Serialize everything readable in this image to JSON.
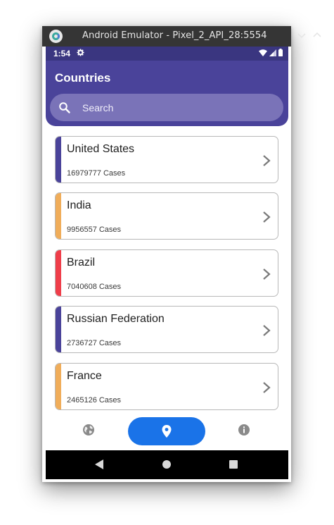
{
  "window": {
    "title": "Android Emulator - Pixel_2_API_28:5554"
  },
  "status_bar": {
    "time": "1:54"
  },
  "app": {
    "title": "Countries",
    "search_placeholder": "Search"
  },
  "countries": [
    {
      "name": "United States",
      "cases": "16979777",
      "cases_suffix": "Cases",
      "color": "#4a439a"
    },
    {
      "name": "India",
      "cases": "9956557",
      "cases_suffix": "Cases",
      "color": "#f0ad5a"
    },
    {
      "name": "Brazil",
      "cases": "7040608",
      "cases_suffix": "Cases",
      "color": "#ef3e4a"
    },
    {
      "name": "Russian Federation",
      "cases": "2736727",
      "cases_suffix": "Cases",
      "color": "#4a439a"
    },
    {
      "name": "France",
      "cases": "2465126",
      "cases_suffix": "Cases",
      "color": "#f0ad5a"
    }
  ],
  "bottom_nav": {
    "items": [
      "globe-icon",
      "location-pin-icon",
      "info-icon"
    ],
    "active": "location-pin-icon",
    "active_color": "#1a73e8"
  },
  "colors": {
    "header": "#4a439a",
    "status_bar": "#3a3680",
    "search_bg": "#7a73b8"
  }
}
